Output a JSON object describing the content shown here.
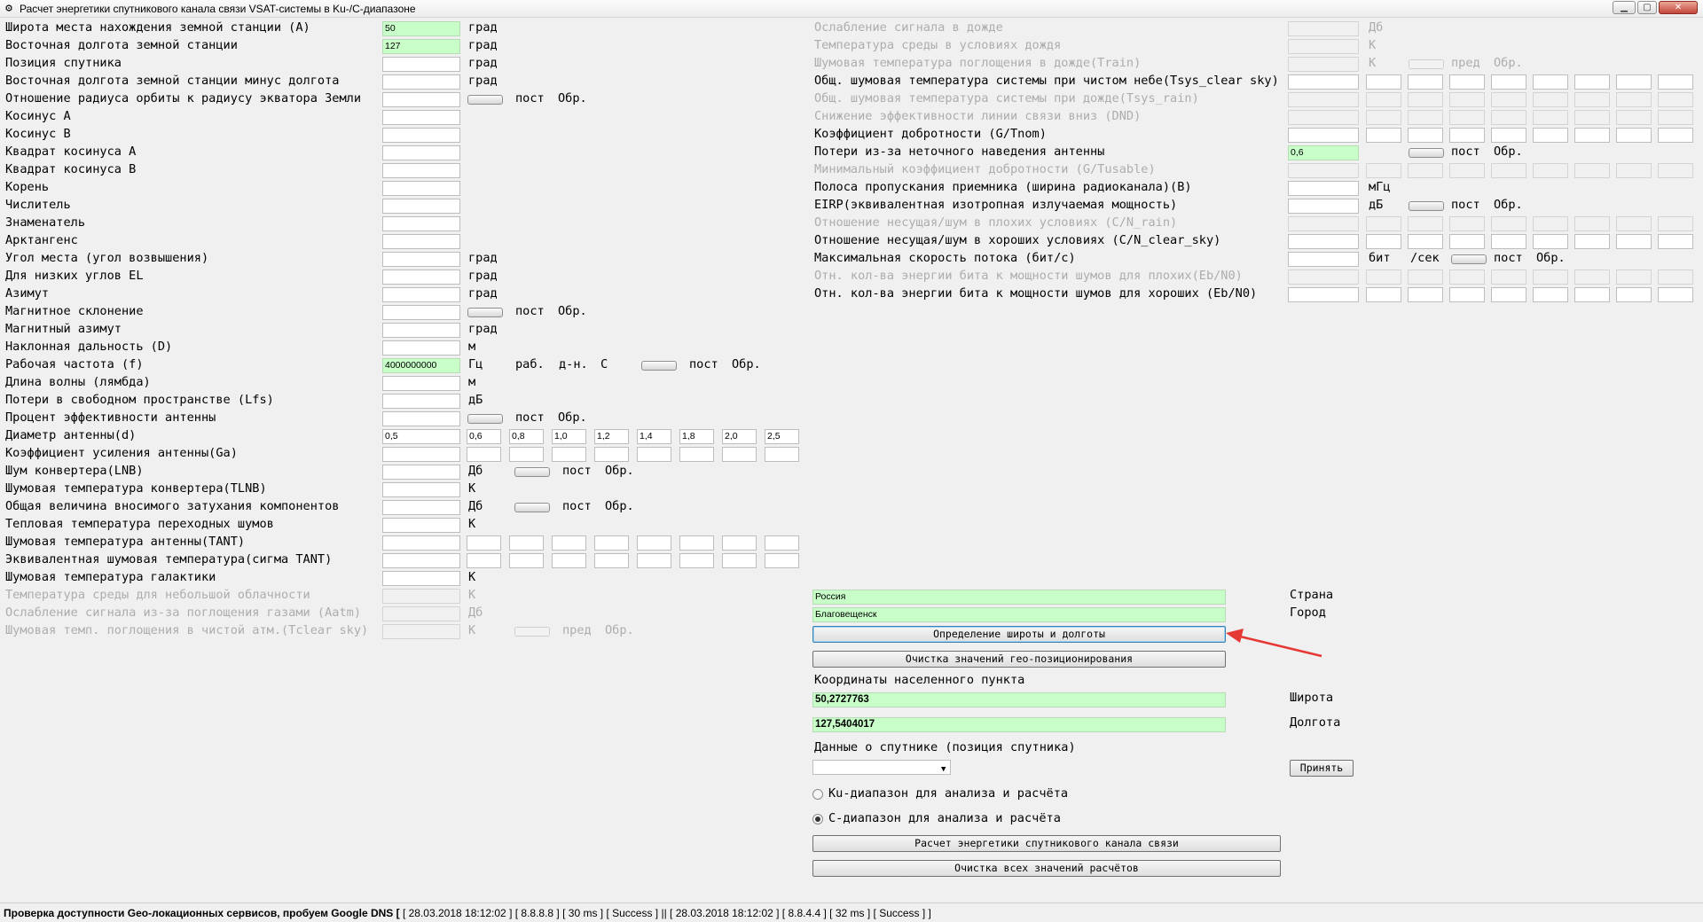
{
  "window": {
    "title": "Расчет энергетики спутникового канала связи VSAT-системы в Ku-/C-диапазоне"
  },
  "left_rows": [
    {
      "label": "Широта места нахождения земной станции (A)",
      "value": "50",
      "field": "green",
      "unit": "град"
    },
    {
      "label": "Восточная долгота земной станции",
      "value": "127",
      "field": "green",
      "unit": "град"
    },
    {
      "label": "Позиция спутника",
      "value": "",
      "field": "white",
      "unit": "град"
    },
    {
      "label": "Восточная долгота земной станции минус долгота",
      "value": "",
      "field": "white",
      "unit": "град"
    },
    {
      "label": "Отношение радиуса  орбиты к радиусу экватора Земли",
      "value": "",
      "field": "white",
      "unit": "",
      "toggle": true,
      "after": "пост",
      "after2": "Обр."
    },
    {
      "label": "Косинус A",
      "value": "",
      "field": "white",
      "unit": ""
    },
    {
      "label": "Косинус B",
      "value": "",
      "field": "white",
      "unit": ""
    },
    {
      "label": "Квадрат косинуса A",
      "value": "",
      "field": "white",
      "unit": ""
    },
    {
      "label": "Квадрат косинуса B",
      "value": "",
      "field": "white",
      "unit": ""
    },
    {
      "label": "Корень",
      "value": "",
      "field": "white",
      "unit": ""
    },
    {
      "label": "Числитель",
      "value": "",
      "field": "white",
      "unit": ""
    },
    {
      "label": "Знаменатель",
      "value": "",
      "field": "white",
      "unit": ""
    },
    {
      "label": "Арктангенс",
      "value": "",
      "field": "white",
      "unit": ""
    },
    {
      "label": "Угол места (угол возвышения)",
      "value": "",
      "field": "white",
      "unit": "град"
    },
    {
      "label": "Для низких углов EL",
      "value": "",
      "field": "white",
      "unit": "град"
    },
    {
      "label": "Азимут",
      "value": "",
      "field": "white",
      "unit": "град"
    },
    {
      "label": "Магнитное склонение",
      "value": "",
      "field": "white",
      "unit": "",
      "toggle": true,
      "after": "пост",
      "after2": "Обр."
    },
    {
      "label": "Магнитный азимут",
      "value": "",
      "field": "white",
      "unit": "град"
    },
    {
      "label": "Наклонная дальность (D)",
      "value": "",
      "field": "white",
      "unit": "м"
    },
    {
      "label": "Рабочая частота (f)",
      "value": "4000000000",
      "field": "green",
      "dropdown": true,
      "unit": "Гц",
      "extra": [
        "раб.",
        "д-н.",
        "C"
      ],
      "toggle2": true,
      "after": "пост",
      "after2": "Обр."
    },
    {
      "label": "Длина волны (лямбда)",
      "value": "",
      "field": "white",
      "unit": "м"
    },
    {
      "label": "Потери в свободном пространстве (Lfs)",
      "value": "",
      "field": "white",
      "unit": "дБ"
    },
    {
      "label": "Процент эффективности антенны",
      "value": "",
      "field": "white",
      "unit": "",
      "toggle": true,
      "after": "пост",
      "after2": "Обр."
    },
    {
      "label": "Диаметр антенны(d)",
      "value": "0,5",
      "field": "white",
      "unit": "",
      "diam": [
        "0,6",
        "0,8",
        "1,0",
        "1,2",
        "1,4",
        "1,8",
        "2,0",
        "2,5"
      ]
    },
    {
      "label": "Коэффициент усиления антенны(Ga)",
      "value": "",
      "field": "white",
      "unit": "",
      "grid": true
    },
    {
      "label": "Шум конвертера(LNB)",
      "value": "",
      "field": "white",
      "unit": "Дб",
      "toggle3": true,
      "after": "пост",
      "after2": "Обр."
    },
    {
      "label": "Шумовая температура конвертера(TLNB)",
      "value": "",
      "field": "white",
      "unit": "К"
    },
    {
      "label": "Общая величина вносимого затухания компонентов",
      "value": "",
      "field": "white",
      "unit": "Дб",
      "toggle3": true,
      "after": "пост",
      "after2": "Обр."
    },
    {
      "label": "Тепловая температура переходных шумов",
      "value": "",
      "field": "white",
      "unit": "К"
    },
    {
      "label": "Шумовая температура антенны(TANT)",
      "value": "",
      "field": "white",
      "unit": "",
      "grid": true
    },
    {
      "label": "Эквивалентная шумовая температура(сигма TANT)",
      "value": "",
      "field": "white",
      "unit": "",
      "grid": true
    },
    {
      "label": "Шумовая температура галактики",
      "value": "",
      "field": "white",
      "unit": "К"
    },
    {
      "label": "Температура среды для небольшой облачности",
      "value": "",
      "field": "disabled",
      "unit": "К",
      "disabled": true
    },
    {
      "label": "Ослабление сигнала из-за поглощения газами (Aatm)",
      "value": "",
      "field": "disabled",
      "unit": "Дб",
      "disabled": true
    },
    {
      "label": "Шумовая темп. поглощения в чистой атм.(Tclear sky)",
      "value": "",
      "field": "disabled",
      "unit": "К",
      "disabled": true,
      "toggle3": true,
      "after": "пред",
      "after2": "Обр."
    }
  ],
  "right_rows": [
    {
      "label": "Ослабление сигнала в дожде",
      "unit": "Дб",
      "disabled": true,
      "field": "disabled"
    },
    {
      "label": "Температура среды в условиях дождя",
      "unit": "К",
      "disabled": true,
      "field": "disabled"
    },
    {
      "label": "Шумовая температура поглощения в дожде(Train)",
      "unit": "К",
      "disabled": true,
      "field": "disabled",
      "toggle": true,
      "after": "пред",
      "after2": "Обр."
    },
    {
      "label": "Общ. шумовая температура системы при чистом небе(Tsys_clear sky)",
      "unit": "",
      "field": "white",
      "grid": true
    },
    {
      "label": "Общ. шумовая температура системы при дожде(Tsys_rain)",
      "unit": "",
      "disabled": true,
      "field": "disabled",
      "grid": true
    },
    {
      "label": "Снижение эффективности линии связи вниз (DND)",
      "unit": "",
      "disabled": true,
      "field": "disabled",
      "grid": true
    },
    {
      "label": "Коэффициент добротности (G/Tnom)",
      "unit": "",
      "field": "white",
      "grid": true
    },
    {
      "label": "Потери из-за неточного наведения антенны",
      "value": "0,6",
      "unit": "",
      "field": "green",
      "toggle": true,
      "after": "пост",
      "after2": "Обр."
    },
    {
      "label": "Минимальный коэффициент добротности (G/Tusable)",
      "unit": "",
      "disabled": true,
      "field": "disabled",
      "grid": true
    },
    {
      "label": "Полоса пропускания приемника (ширина радиоканала)(B)",
      "unit": "мГц",
      "field": "white",
      "dropdown": true
    },
    {
      "label": "EIRP(эквивалентная изотропная излучаемая мощность)",
      "unit": "дБ",
      "field": "white",
      "toggle": true,
      "after": "пост",
      "after2": "Обр."
    },
    {
      "label": "Отношение несущая/шум в плохих условиях (C/N_rain)",
      "unit": "",
      "disabled": true,
      "field": "disabled",
      "grid": true
    },
    {
      "label": "Отношение несущая/шум в хороших условиях (C/N_clear_sky)",
      "unit": "",
      "field": "white",
      "grid": true
    },
    {
      "label": "Максимальная скорость потока (бит/с)",
      "unit": "бит",
      "unit2": "/сек",
      "field": "white",
      "toggle2": true,
      "after": "пост",
      "after2": "Обр."
    },
    {
      "label": "Отн. кол-ва энергии бита к мощности шумов для плохих(Eb/N0)",
      "unit": "",
      "disabled": true,
      "field": "disabled",
      "grid": true
    },
    {
      "label": "Отн. кол-ва энергии бита к мощности шумов для хороших (Eb/N0)",
      "unit": "",
      "field": "white",
      "grid": true
    }
  ],
  "geo": {
    "country_value": "Россия",
    "country_label": "Страна",
    "city_value": "Благовещенск",
    "city_label": "Город",
    "determine_button": "Определение широты и долготы",
    "clear_geo_button": "Очистка значений гео-позиционирования",
    "coords_heading": "Координаты населенного пункта",
    "lat_value": "50,2727763",
    "lat_label": "Широта",
    "lon_value": "127,5404017",
    "lon_label": "Долгота",
    "sat_heading": "Данные о спутнике (позиция спутника)",
    "accept_button": "Принять",
    "ku_radio": "Ku-диапазон для анализа и расчёта",
    "c_radio": "С-диапазон для анализа и расчёта",
    "calc_button": "Расчет энергетики спутникового канала связи",
    "clear_all_button": "Очистка всех значений расчётов"
  },
  "annotation": {
    "color": "#e53935"
  },
  "status": {
    "bold": "Проверка доступности Geo-локационных сервисов, пробуем Google DNS [",
    "rest": " [ 28.03.2018 18:12:02 ] [ 8.8.8.8 ] [ 30 ms ] [ Success ]  ||  [ 28.03.2018 18:12:02 ] [ 8.8.4.4 ] [ 32 ms ] [ Success ]  ]"
  }
}
